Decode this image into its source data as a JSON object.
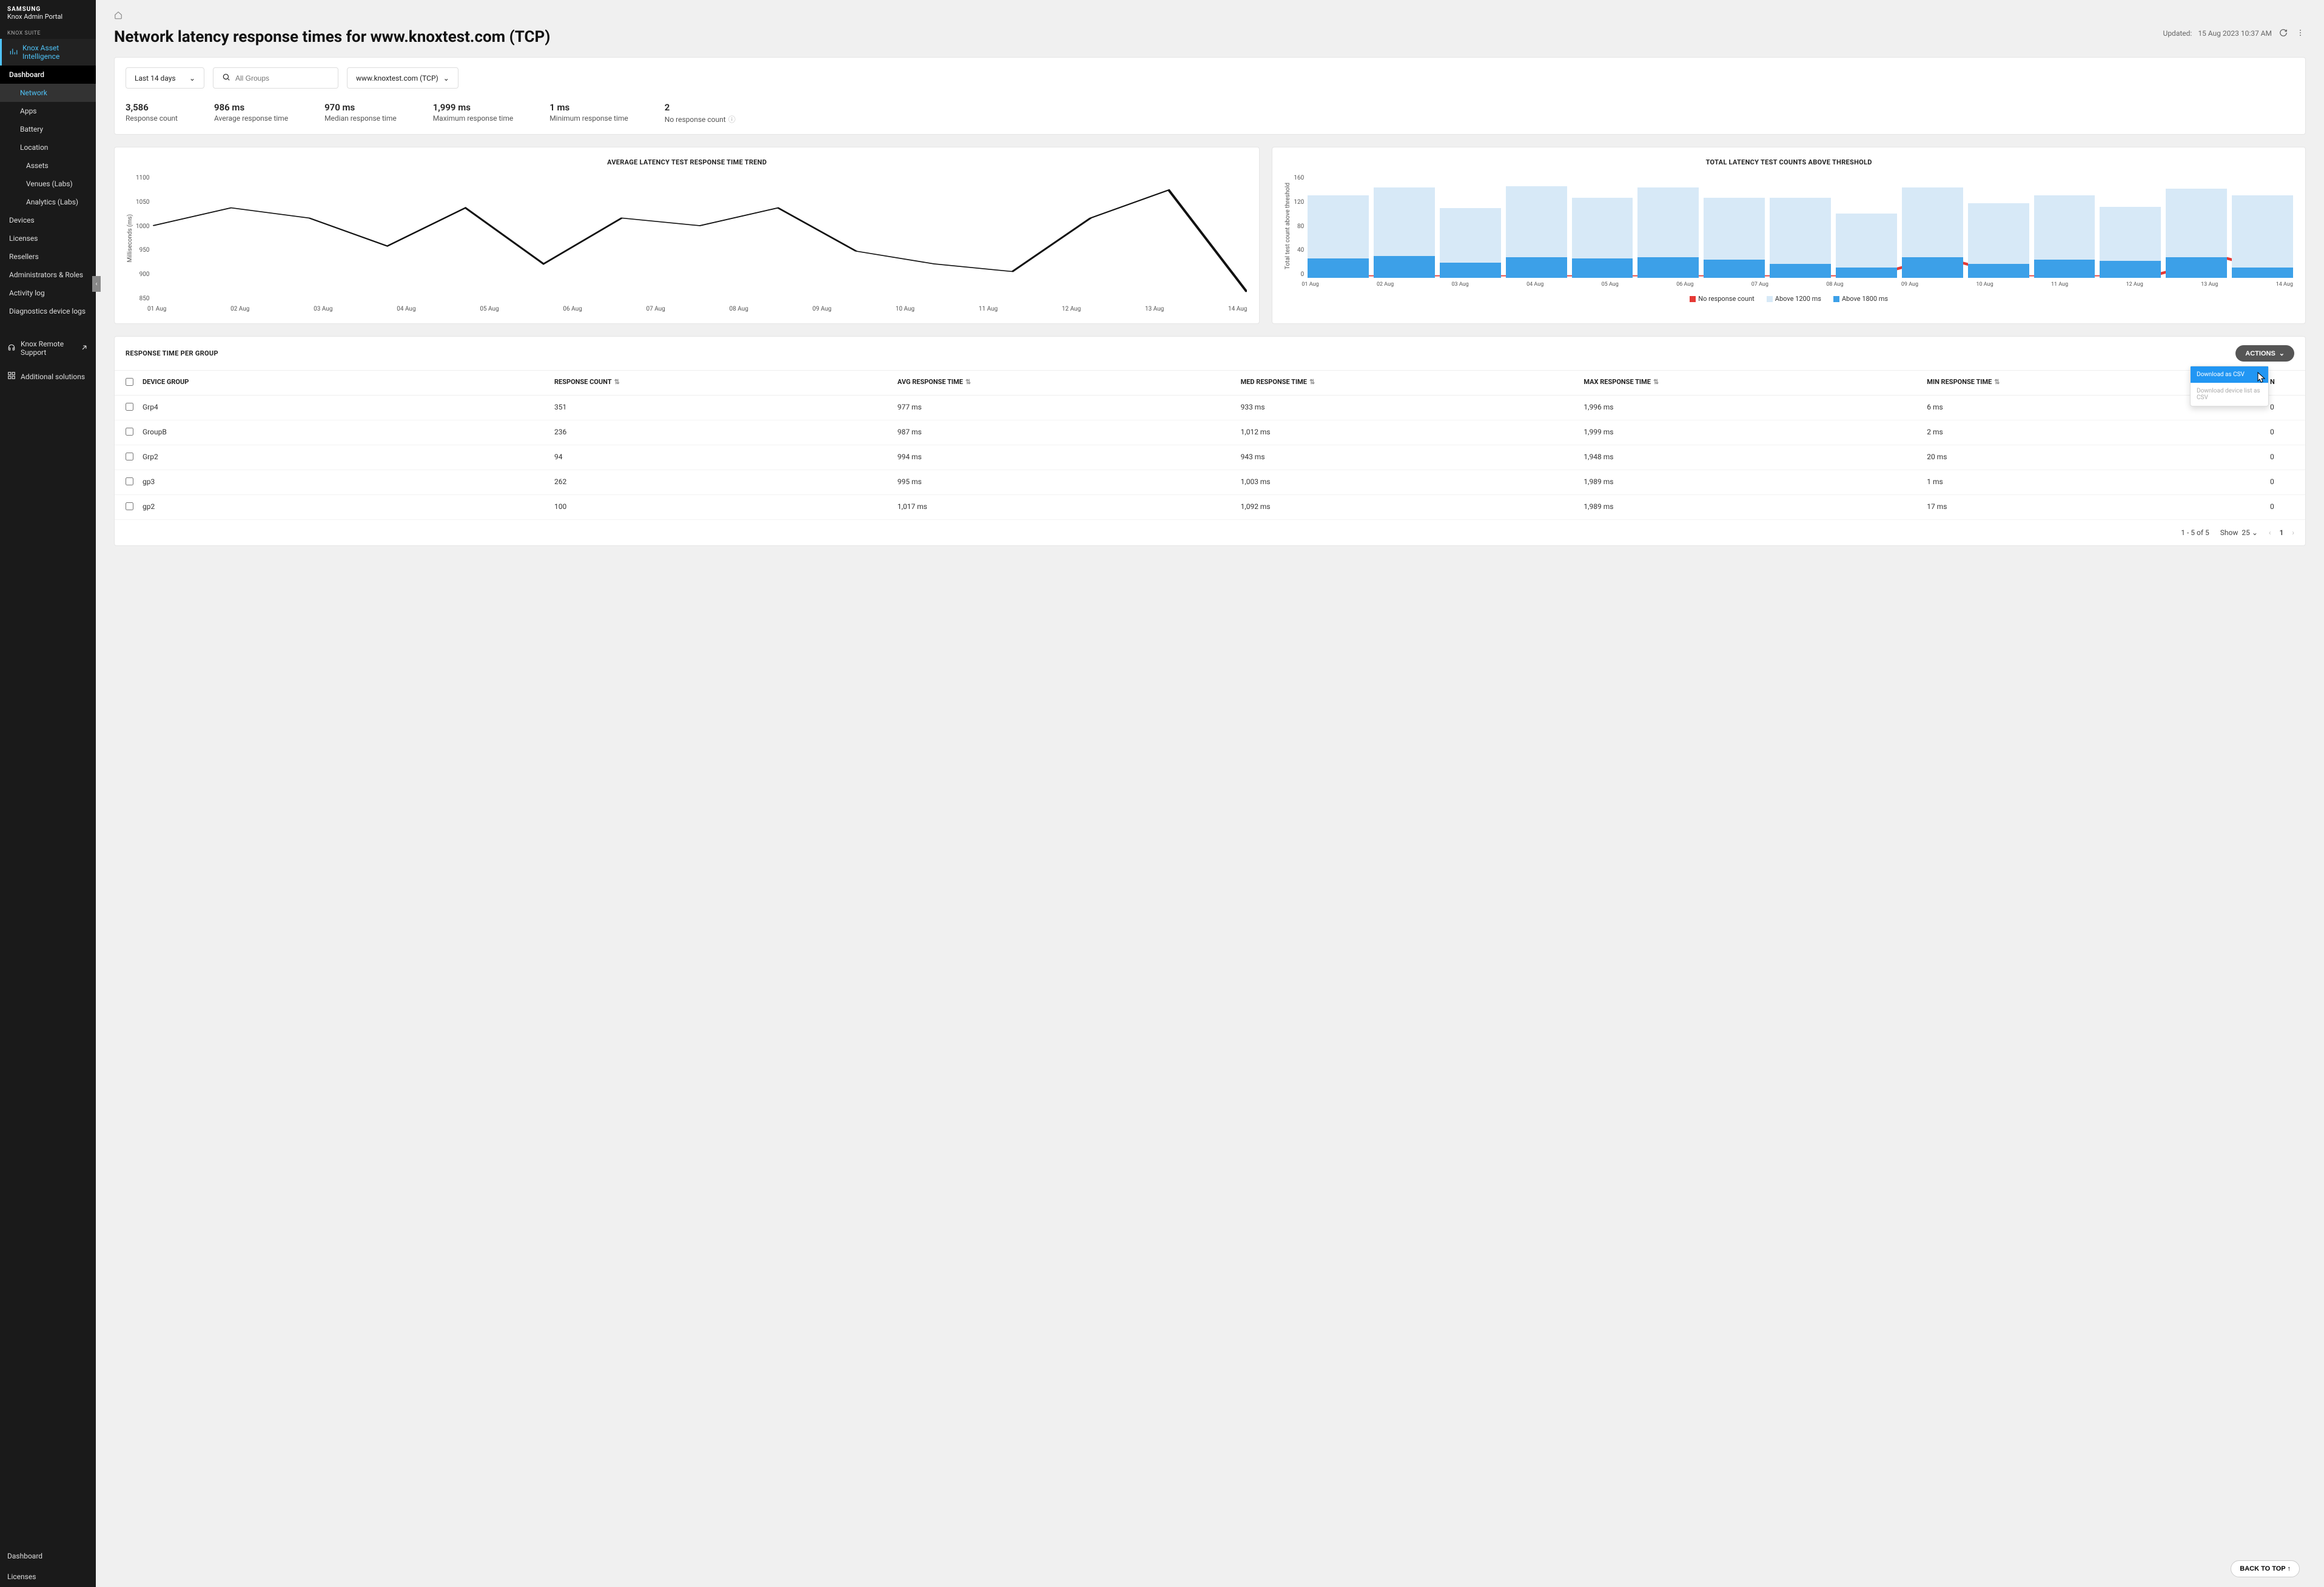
{
  "brand": {
    "maker": "SAMSUNG",
    "product": "Knox Admin Portal"
  },
  "sidebar": {
    "section": "KNOX SUITE",
    "kai": "Knox Asset Intelligence",
    "dashboard": "Dashboard",
    "items": [
      "Network",
      "Apps",
      "Battery",
      "Location"
    ],
    "location_children": [
      "Assets",
      "Venues (Labs)",
      "Analytics (Labs)"
    ],
    "top_level": [
      "Devices",
      "Licenses",
      "Resellers",
      "Administrators & Roles",
      "Activity log",
      "Diagnostics device logs"
    ],
    "remote": "Knox Remote Support",
    "additional": "Additional solutions",
    "bottom": [
      "Dashboard",
      "Licenses"
    ]
  },
  "page": {
    "title": "Network latency response times for www.knoxtest.com (TCP)",
    "updated_label": "Updated:",
    "updated_value": "15 Aug 2023 10:37 AM"
  },
  "filters": {
    "range": "Last 14 days",
    "groups_placeholder": "All Groups",
    "host": "www.knoxtest.com (TCP)"
  },
  "kpis": [
    {
      "value": "3,586",
      "label": "Response count"
    },
    {
      "value": "986 ms",
      "label": "Average response time"
    },
    {
      "value": "970 ms",
      "label": "Median response time"
    },
    {
      "value": "1,999 ms",
      "label": "Maximum response time"
    },
    {
      "value": "1 ms",
      "label": "Minimum response time"
    },
    {
      "value": "2",
      "label": "No response count",
      "info": true
    }
  ],
  "chart_data": [
    {
      "type": "line",
      "title": "AVERAGE LATENCY TEST RESPONSE TIME TREND",
      "ylabel": "Milliseconds (ms)",
      "categories": [
        "01 Aug",
        "02 Aug",
        "03 Aug",
        "04 Aug",
        "05 Aug",
        "06 Aug",
        "07 Aug",
        "08 Aug",
        "09 Aug",
        "10 Aug",
        "11 Aug",
        "12 Aug",
        "13 Aug",
        "14 Aug"
      ],
      "values": [
        1000,
        1035,
        1015,
        960,
        1035,
        925,
        1015,
        1000,
        1035,
        950,
        925,
        910,
        1015,
        1070,
        870
      ],
      "ylim": [
        850,
        1100
      ],
      "y_ticks": [
        1100,
        1050,
        1000,
        950,
        900,
        850
      ]
    },
    {
      "type": "bar",
      "title": "TOTAL LATENCY TEST COUNTS ABOVE THRESHOLD",
      "ylabel": "Total test count above threshold",
      "categories": [
        "01 Aug",
        "02 Aug",
        "03 Aug",
        "04 Aug",
        "05 Aug",
        "06 Aug",
        "07 Aug",
        "08 Aug",
        "09 Aug",
        "10 Aug",
        "11 Aug",
        "12 Aug",
        "13 Aug",
        "14 Aug"
      ],
      "series": [
        {
          "name": "Above 1200 ms",
          "values": [
            128,
            140,
            108,
            142,
            124,
            140,
            124,
            124,
            100,
            140,
            116,
            128,
            110,
            138,
            128
          ]
        },
        {
          "name": "Above 1800 ms",
          "values": [
            30,
            34,
            24,
            32,
            30,
            32,
            28,
            22,
            16,
            32,
            22,
            28,
            26,
            32,
            16
          ]
        },
        {
          "name": "No response count",
          "values": [
            0,
            0,
            0,
            0,
            0,
            0,
            0,
            0,
            0,
            1,
            0,
            0,
            0,
            1,
            0
          ]
        }
      ],
      "ylim": [
        0,
        160
      ],
      "y_ticks": [
        160,
        120,
        80,
        40,
        0
      ],
      "legend": [
        "No response count",
        "Above 1200 ms",
        "Above 1800 ms"
      ]
    }
  ],
  "table": {
    "title": "RESPONSE TIME PER GROUP",
    "actions_label": "ACTIONS",
    "menu": {
      "download_csv": "Download as CSV",
      "download_device": "Download device list as CSV"
    },
    "columns": [
      "DEVICE GROUP",
      "RESPONSE COUNT",
      "AVG RESPONSE TIME",
      "MED RESPONSE TIME",
      "MAX RESPONSE TIME",
      "MIN RESPONSE TIME",
      "N"
    ],
    "rows": [
      {
        "group": "Grp4",
        "count": "351",
        "avg": "977 ms",
        "med": "933 ms",
        "max": "1,996 ms",
        "min": "6 ms",
        "nr": "0"
      },
      {
        "group": "GroupB",
        "count": "236",
        "avg": "987 ms",
        "med": "1,012 ms",
        "max": "1,999 ms",
        "min": "2 ms",
        "nr": "0"
      },
      {
        "group": "Grp2",
        "count": "94",
        "avg": "994 ms",
        "med": "943 ms",
        "max": "1,948 ms",
        "min": "20 ms",
        "nr": "0"
      },
      {
        "group": "gp3",
        "count": "262",
        "avg": "995 ms",
        "med": "1,003 ms",
        "max": "1,989 ms",
        "min": "1 ms",
        "nr": "0"
      },
      {
        "group": "gp2",
        "count": "100",
        "avg": "1,017 ms",
        "med": "1,092 ms",
        "max": "1,989 ms",
        "min": "17 ms",
        "nr": "0"
      }
    ],
    "footer": {
      "range": "1 - 5 of 5",
      "show": "Show",
      "page_size": "25",
      "page": "1"
    }
  },
  "back_to_top": "BACK TO TOP ↑"
}
